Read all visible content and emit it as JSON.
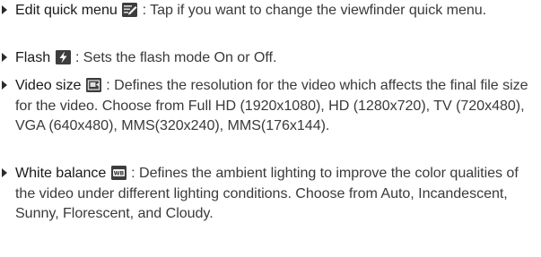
{
  "items": [
    {
      "term": "Edit quick menu",
      "icon": "edit-quick-menu-icon",
      "desc": " : Tap if you want to change the viewfinder quick menu."
    },
    {
      "term": "Flash",
      "icon": "flash-icon",
      "desc": " : Sets the flash mode On or Off."
    },
    {
      "term": "Video size",
      "icon": "video-size-icon",
      "desc": " : Defines the resolution for the video which affects the final file size for the video. Choose from Full HD (1920x1080), HD (1280x720), TV (720x480), VGA (640x480), MMS(320x240), MMS(176x144)."
    },
    {
      "term": "White balance",
      "icon": "white-balance-icon",
      "icon_text": "WB",
      "desc": " : Defines the ambient lighting to improve the color qualities of the video under different lighting conditions. Choose from Auto, Incandescent, Sunny, Florescent, and Cloudy."
    }
  ],
  "colors": {
    "text": "#3a3a3a",
    "term": "#1a1a1a",
    "icon_dark": "#333333"
  }
}
